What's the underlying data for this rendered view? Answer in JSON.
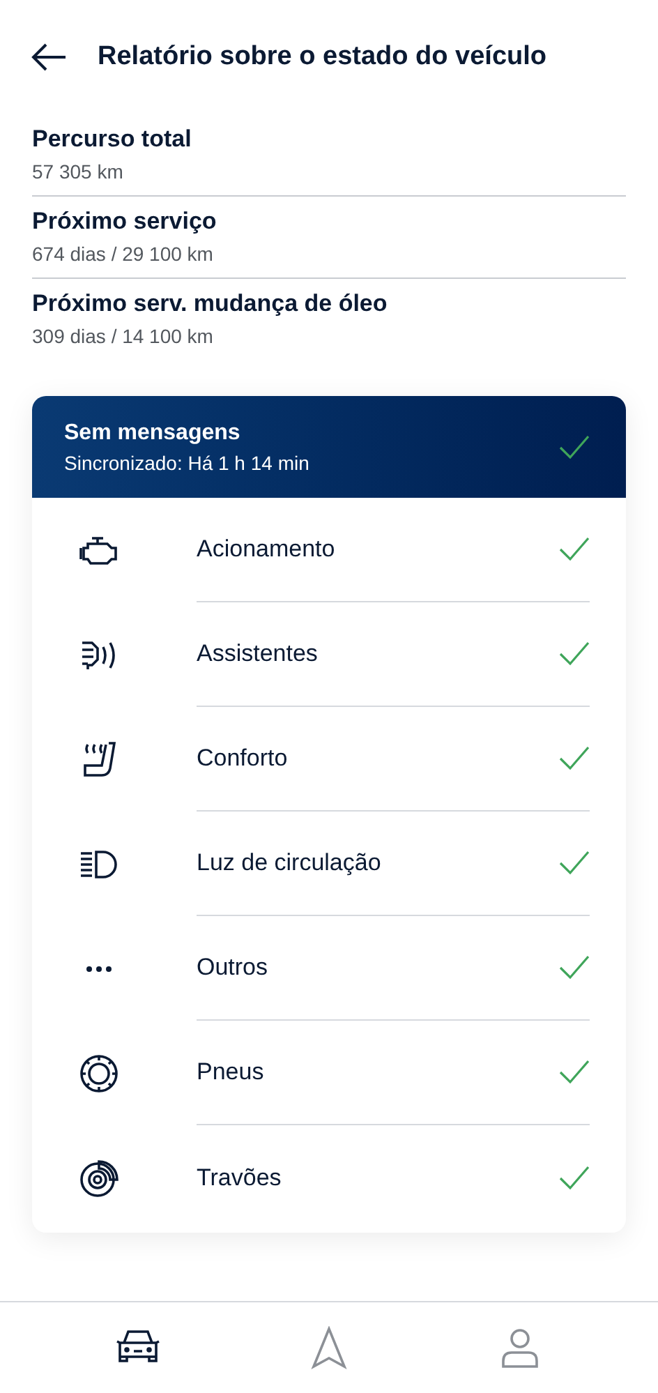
{
  "header": {
    "title": "Relatório sobre o estado do veículo"
  },
  "stats": [
    {
      "label": "Percurso total",
      "value": "57 305 km"
    },
    {
      "label": "Próximo serviço",
      "value": "674 dias / 29 100 km"
    },
    {
      "label": "Próximo serv. mudança de óleo",
      "value": "309 dias / 14 100 km"
    }
  ],
  "status_card": {
    "title": "Sem mensagens",
    "subtitle": "Sincronizado: Há 1 h 14 min",
    "ok": true,
    "items": [
      {
        "label": "Acionamento",
        "ok": true
      },
      {
        "label": "Assistentes",
        "ok": true
      },
      {
        "label": "Conforto",
        "ok": true
      },
      {
        "label": "Luz de circulação",
        "ok": true
      },
      {
        "label": "Outros",
        "ok": true
      },
      {
        "label": "Pneus",
        "ok": true
      },
      {
        "label": "Travões",
        "ok": true
      }
    ]
  },
  "bottom_nav": [
    {
      "selected": true
    },
    {
      "selected": false
    },
    {
      "selected": false
    }
  ]
}
